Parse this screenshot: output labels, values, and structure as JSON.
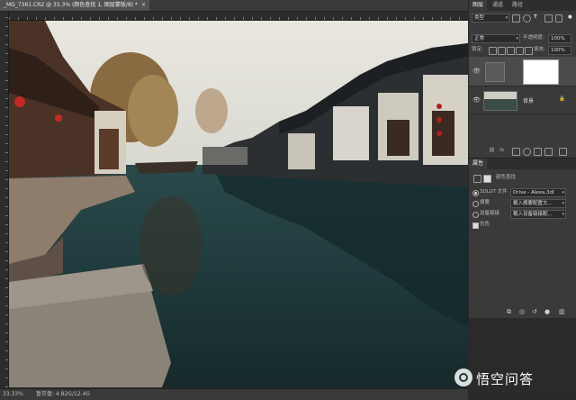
{
  "document": {
    "tab_title": "_MG_7361.CR2 @ 33.3% (颜色查找 1, 图层蒙版/8) *",
    "tab_close": "×"
  },
  "status": {
    "zoom": "33.33%",
    "doc_info": "暂存盘: 4.82G/12.4G"
  },
  "layers_panel": {
    "tabs": [
      {
        "label": "图层"
      },
      {
        "label": "通道"
      },
      {
        "label": "路径"
      }
    ],
    "filter_label": "类型",
    "blend_mode": "正常",
    "opacity_label": "不透明度:",
    "opacity_value": "100%",
    "lock_label": "锁定:",
    "fill_label": "填充:",
    "fill_value": "100%",
    "layers": [
      {
        "name": "",
        "kind": "adjustment",
        "visible": true
      },
      {
        "name": "背景",
        "kind": "background",
        "visible": true
      }
    ]
  },
  "properties_panel": {
    "tabs": [
      {
        "label": "属性"
      }
    ],
    "heading": "颜色查找",
    "rows": [
      {
        "label": "3DLUT 文件",
        "value": "Drive - Alexa.3dl",
        "control": "radio",
        "checked": true
      },
      {
        "label": "摘要",
        "value": "载入摘要配置文...",
        "control": "radio",
        "checked": false
      },
      {
        "label": "设备链接",
        "value": "载入设备链接配...",
        "control": "radio",
        "checked": false
      },
      {
        "label": "仿色",
        "value": "",
        "control": "checkbox",
        "checked": true
      }
    ]
  },
  "watermark": {
    "text": "悟空问答"
  },
  "colors": {
    "panel_bg": "#3a3a3a",
    "workspace_bg": "#282828",
    "water": "#1f3a3b",
    "sky": "#e8e6df"
  }
}
